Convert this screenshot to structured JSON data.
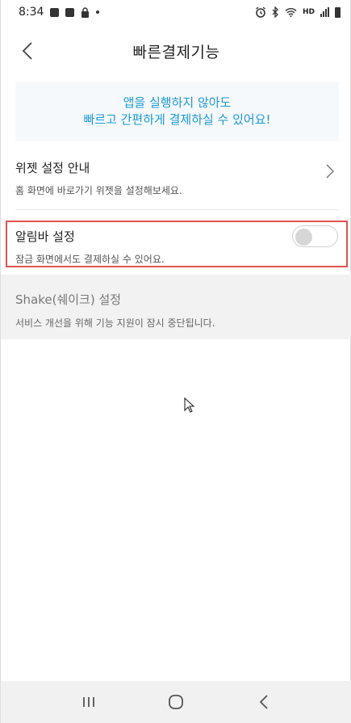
{
  "status_bar": {
    "time": "8:34",
    "hd_label": "HD",
    "left_icons": [
      "gallery-icon",
      "news-icon",
      "lock-icon"
    ],
    "right_icons": [
      "alarm-icon",
      "bluetooth-icon",
      "wifi-icon",
      "signal-icon",
      "battery-icon"
    ]
  },
  "header": {
    "title": "빠른결제기능",
    "back_icon": "chevron-left-icon"
  },
  "notice": {
    "line1": "앱을 실행하지 않아도",
    "line2": "빠르고 간편하게 결제하실 수 있어요!",
    "color": "#1a9ad6"
  },
  "settings": {
    "widget": {
      "title": "위젯 설정 안내",
      "description": "홈 화면에 바로가기 위젯을 설정해보세요."
    },
    "alarm_bar": {
      "title": "알림바 설정",
      "description": "잠금 화면에서도 결제하실 수 있어요.",
      "toggle_on": false
    },
    "shake": {
      "title": "Shake(쉐이크) 설정",
      "description": "서비스 개선을 위해 기능 지원이 잠시 중단됩니다.",
      "disabled": true
    }
  },
  "highlight_color": "#e05252",
  "nav_bar": {
    "buttons": [
      "recent-apps-icon",
      "home-icon",
      "back-icon"
    ]
  }
}
